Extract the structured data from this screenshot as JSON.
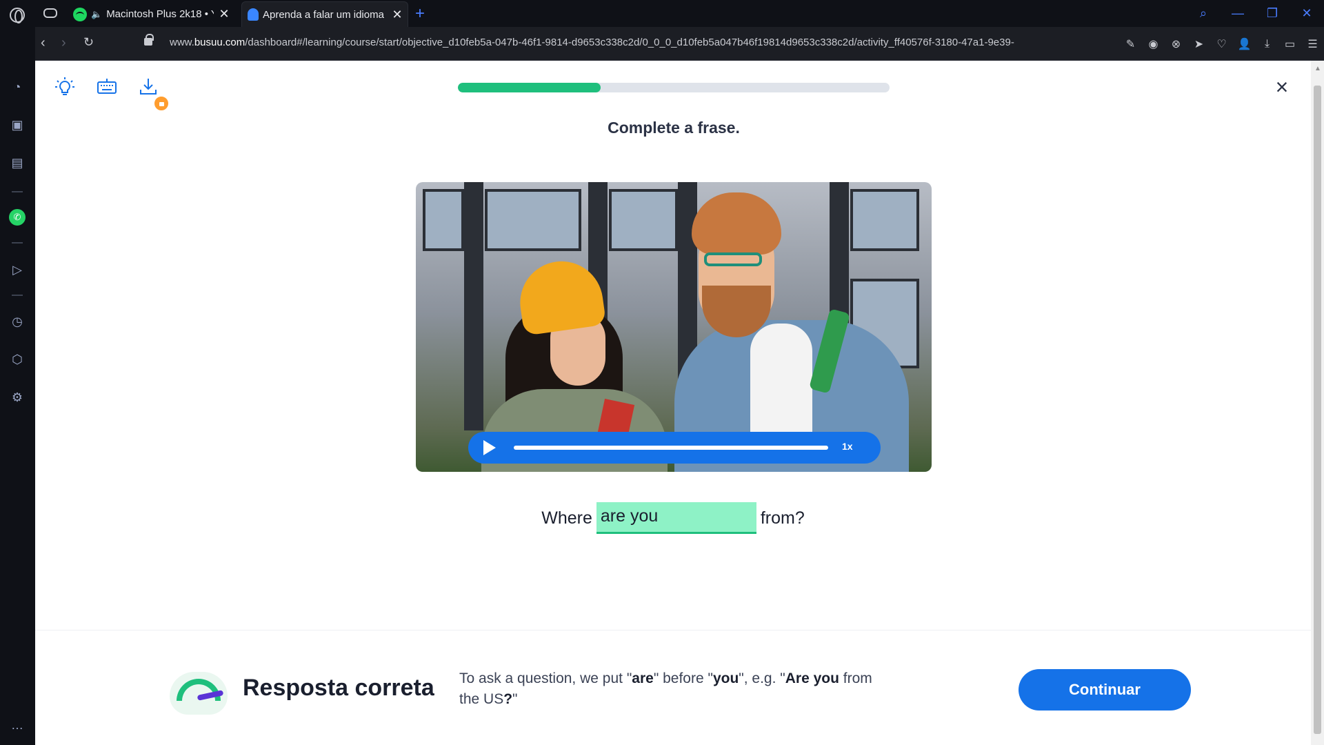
{
  "browser": {
    "tabs": [
      {
        "label": "Macintosh Plus 2k18 • Y"
      },
      {
        "label": "Aprenda a falar um idioma"
      }
    ],
    "url_prefix": "www.",
    "url_domain": "busuu.com",
    "url_path": "/dashboard#/learning/course/start/objective_d10feb5a-047b-46f1-9814-d9653c338c2d/0_0_0_d10feb5a047b46f19814d9653c338c2d/activity_ff40576f-3180-47a1-9e39-",
    "new_tab_glyph": "+",
    "close_glyph": "✕"
  },
  "exercise": {
    "progress": 0.33,
    "instruction": "Complete a frase.",
    "audio_speed": "1x",
    "sentence_before": "Where",
    "answer": "are you",
    "sentence_after": "from?"
  },
  "feedback": {
    "title": "Resposta correta",
    "explanation": {
      "p1": "To ask a question, we put \"",
      "b1": "are",
      "p2": "\" before \"",
      "b2": "you",
      "p3": "\", e.g. \"",
      "b3": "Are you",
      "p4": " from the US",
      "b4": "?",
      "p5": "\""
    },
    "continue_label": "Continuar"
  },
  "colors": {
    "accent_blue": "#1572e8",
    "success_green": "#1fbf7d",
    "answer_fill": "#8ef2c6"
  }
}
